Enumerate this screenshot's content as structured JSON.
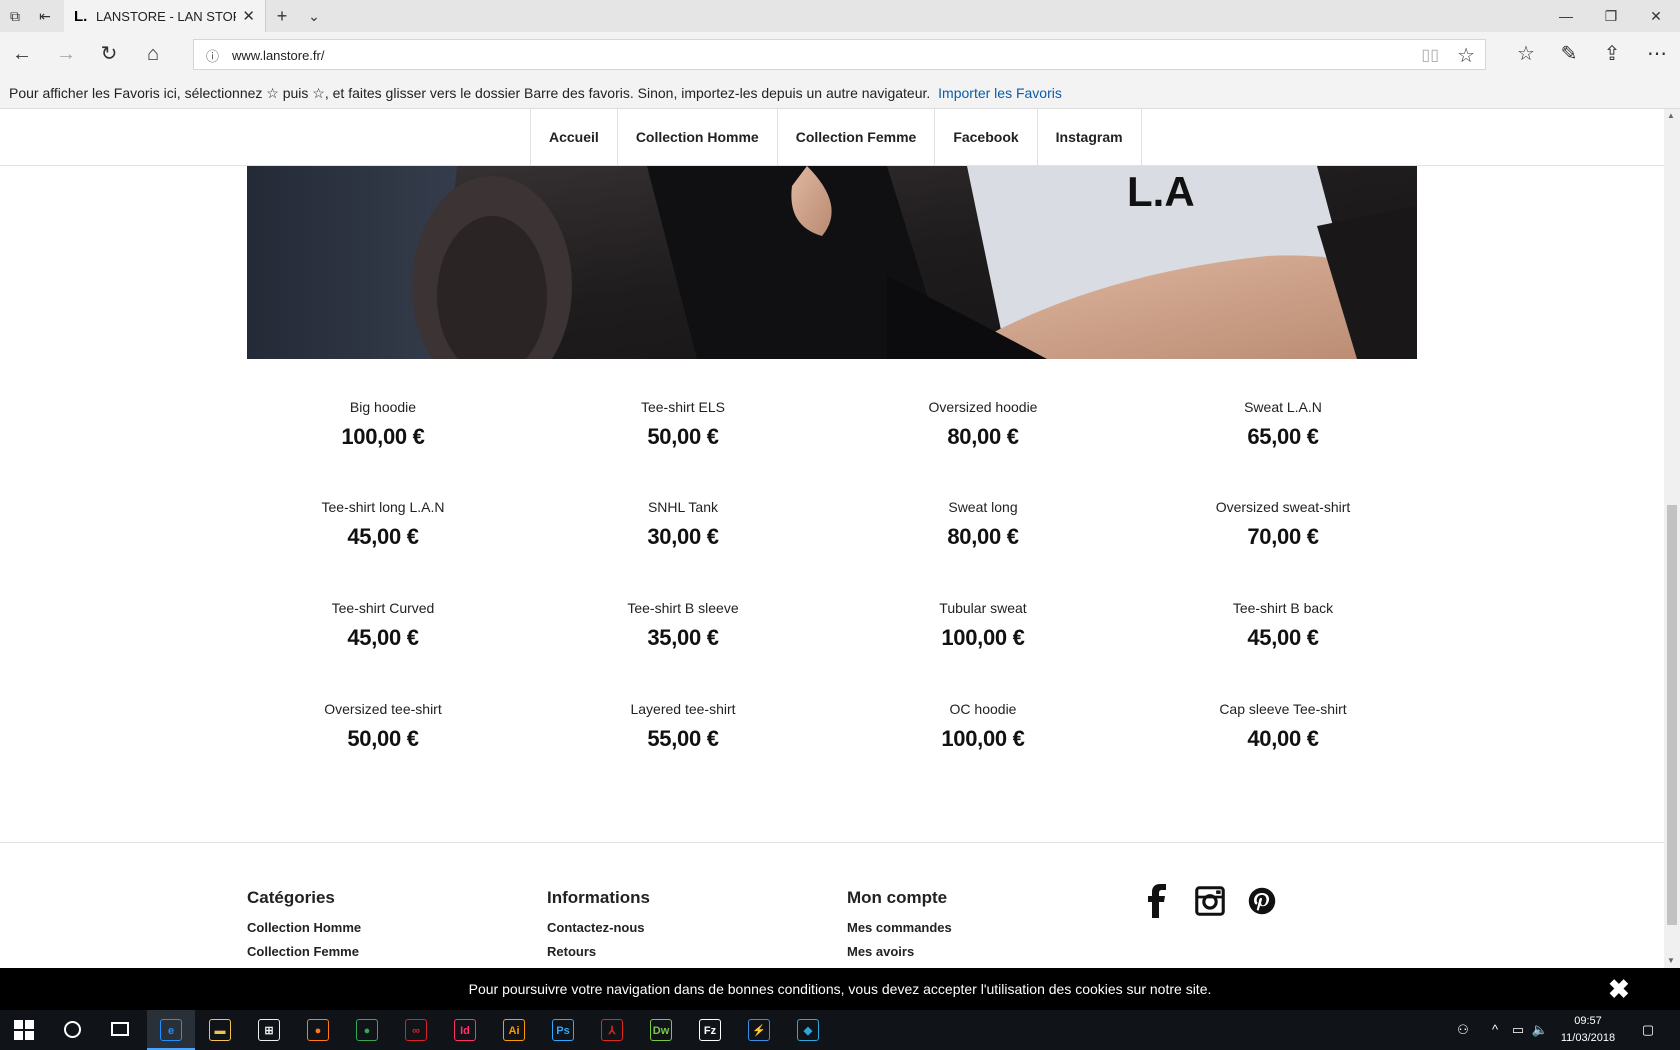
{
  "browser": {
    "tab_logo": "L.",
    "tab_title": "LANSTORE - LAN STORE",
    "url": "www.lanstore.fr/",
    "favorites_message": "Pour afficher les Favoris ici, sélectionnez  ☆  puis ☆, et faites glisser vers le dossier Barre des favoris. Sinon, importez-les depuis un autre navigateur.",
    "favorites_link": "Importer les Favoris"
  },
  "nav": {
    "items": [
      {
        "label": "Accueil"
      },
      {
        "label": "Collection Homme"
      },
      {
        "label": "Collection Femme"
      },
      {
        "label": "Facebook"
      },
      {
        "label": "Instagram"
      }
    ]
  },
  "hero": {
    "logo_text": "L.A"
  },
  "products": [
    {
      "name": "Big hoodie",
      "price": "100,00 €"
    },
    {
      "name": "Tee-shirt ELS",
      "price": "50,00 €"
    },
    {
      "name": "Oversized hoodie",
      "price": "80,00 €"
    },
    {
      "name": "Sweat L.A.N",
      "price": "65,00 €"
    },
    {
      "name": "Tee-shirt long L.A.N",
      "price": "45,00 €"
    },
    {
      "name": "SNHL Tank",
      "price": "30,00 €"
    },
    {
      "name": "Sweat long",
      "price": "80,00 €"
    },
    {
      "name": "Oversized sweat-shirt",
      "price": "70,00 €"
    },
    {
      "name": "Tee-shirt Curved",
      "price": "45,00 €"
    },
    {
      "name": "Tee-shirt B sleeve",
      "price": "35,00 €"
    },
    {
      "name": "Tubular sweat",
      "price": "100,00 €"
    },
    {
      "name": "Tee-shirt B back",
      "price": "45,00 €"
    },
    {
      "name": "Oversized tee-shirt",
      "price": "50,00 €"
    },
    {
      "name": "Layered tee-shirt",
      "price": "55,00 €"
    },
    {
      "name": "OC hoodie",
      "price": "100,00 €"
    },
    {
      "name": "Cap sleeve Tee-shirt",
      "price": "40,00 €"
    }
  ],
  "footer": {
    "categories": {
      "title": "Catégories",
      "links": [
        "Collection Homme",
        "Collection Femme"
      ]
    },
    "informations": {
      "title": "Informations",
      "links": [
        "Contactez-nous",
        "Retours"
      ]
    },
    "account": {
      "title": "Mon compte",
      "links": [
        "Mes commandes",
        "Mes avoirs"
      ]
    }
  },
  "cookie": {
    "message": "Pour poursuivre votre navigation dans de bonnes conditions, vous devez accepter l'utilisation des cookies sur notre site.",
    "close": "✖"
  },
  "taskbar": {
    "apps": [
      {
        "name": "Edge",
        "glyph": "e",
        "color": "#1e90ff"
      },
      {
        "name": "Explorer",
        "glyph": "▬",
        "color": "#f2c14e"
      },
      {
        "name": "Store",
        "glyph": "⊞",
        "color": "#eee"
      },
      {
        "name": "Firefox",
        "glyph": "●",
        "color": "#ff7a1a"
      },
      {
        "name": "Chrome",
        "glyph": "●",
        "color": "#34a853"
      },
      {
        "name": "Creative Cloud",
        "glyph": "∞",
        "color": "#da1f26"
      },
      {
        "name": "InDesign",
        "glyph": "Id",
        "color": "#ff3366"
      },
      {
        "name": "Illustrator",
        "glyph": "Ai",
        "color": "#ff9a00"
      },
      {
        "name": "Photoshop",
        "glyph": "Ps",
        "color": "#31a8ff"
      },
      {
        "name": "Acrobat",
        "glyph": "⅄",
        "color": "#e0281c"
      },
      {
        "name": "Dreamweaver",
        "glyph": "Dw",
        "color": "#7ac943"
      },
      {
        "name": "FileZilla",
        "glyph": "Fz",
        "color": "#ffffff"
      },
      {
        "name": "Thunderbolt",
        "glyph": "⚡",
        "color": "#3a8ee6"
      },
      {
        "name": "VirtualBox",
        "glyph": "◆",
        "color": "#2ea7e0"
      }
    ],
    "time": "09:57",
    "date": "11/03/2018"
  }
}
